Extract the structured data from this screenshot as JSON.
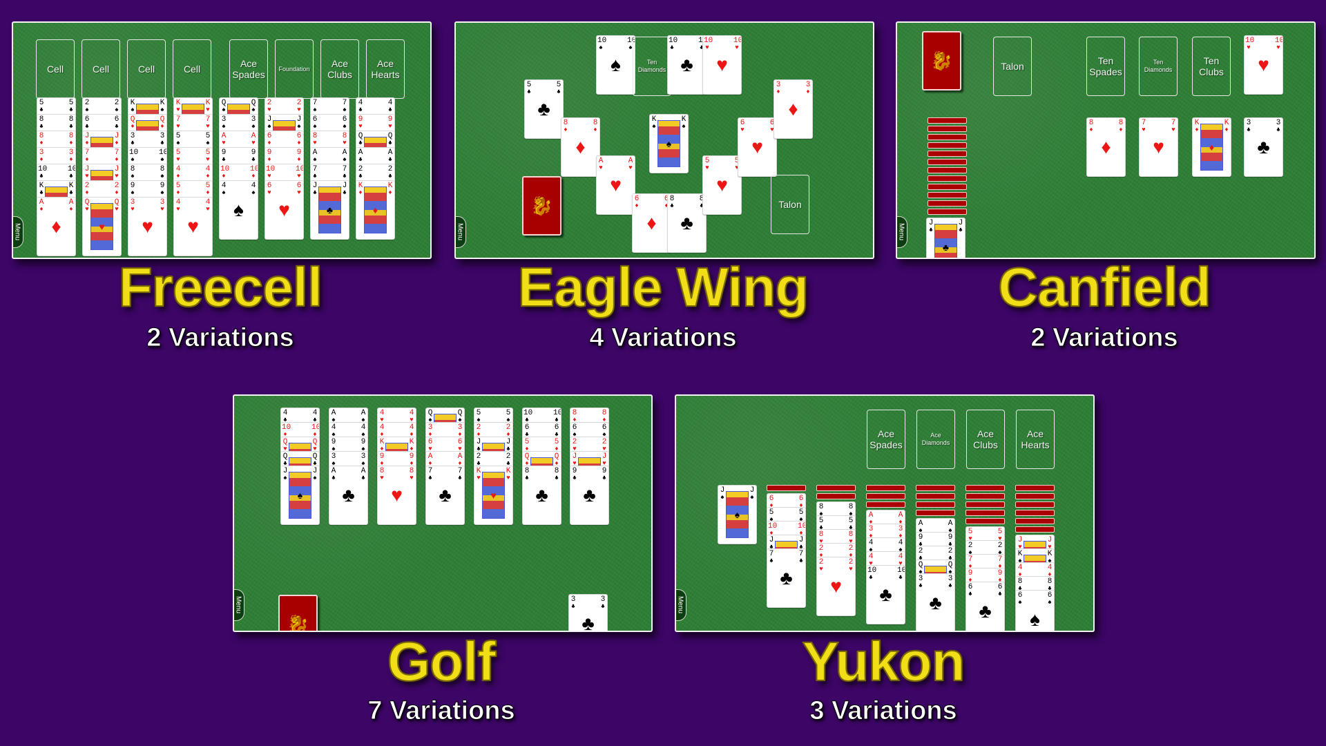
{
  "colors": {
    "background": "#3c0566",
    "felt": "#2f7f36",
    "title": "#f2de16",
    "card_back": "#a80000",
    "red_suit": "#ee1515",
    "black_suit": "#000000"
  },
  "menu_label": "Menu",
  "games": [
    {
      "id": "freecell",
      "title": "Freecell",
      "subtitle": "2 Variations",
      "slots": [
        {
          "label": "Cell"
        },
        {
          "label": "Cell"
        },
        {
          "label": "Cell"
        },
        {
          "label": "Cell"
        },
        {
          "label": "Ace Spades"
        },
        {
          "label": "Foundation",
          "small": true
        },
        {
          "label": "Ace Clubs"
        },
        {
          "label": "Ace Hearts"
        }
      ],
      "tableau": [
        [
          "5♣",
          "8♣",
          "8♦",
          "3♦",
          "10♣",
          "K♣",
          "A♦"
        ],
        [
          "2♠",
          "6♣",
          "J♦",
          "7♦",
          "J♥",
          "2♦",
          "Q♥"
        ],
        [
          "K♠",
          "Q♦",
          "3♣",
          "10♠",
          "8♠",
          "9♠",
          "3♥"
        ],
        [
          "K♥",
          "7♥",
          "5♠",
          "5♥",
          "4♦",
          "5♦",
          "4♥"
        ],
        [
          "Q♠",
          "3♠",
          "A♥",
          "9♣",
          "10♦",
          "4♠"
        ],
        [
          "2♥",
          "J♠",
          "6♦",
          "9♦",
          "10♥",
          "6♥"
        ],
        [
          "7♠",
          "6♠",
          "8♥",
          "A♠",
          "7♣",
          "J♣"
        ],
        [
          "4♣",
          "9♥",
          "Q♣",
          "A♣",
          "2♣",
          "K♦"
        ]
      ]
    },
    {
      "id": "eagle-wing",
      "title": "Eagle Wing",
      "subtitle": "4 Variations",
      "foundations": [
        "10♠",
        {
          "label": "Ten Diamonds"
        },
        "10♣",
        "10♥"
      ],
      "wing_cards": [
        "5♣",
        "8♦",
        "A♥",
        "6♦",
        "8♣",
        "5♥",
        "6♥",
        "3♦"
      ],
      "trunk": "K♠",
      "stock": "back",
      "talon": {
        "label": "Talon"
      }
    },
    {
      "id": "canfield",
      "title": "Canfield",
      "subtitle": "2 Variations",
      "stock": "back",
      "talon": {
        "label": "Talon"
      },
      "foundations": [
        {
          "label": "Ten Spades"
        },
        {
          "label": "Ten Diamonds"
        },
        {
          "label": "Ten Clubs"
        },
        "10♥"
      ],
      "reserve_backs": 12,
      "reserve_top": "J♣",
      "tableau": [
        "8♦",
        "7♥",
        "K♦",
        "3♣"
      ]
    },
    {
      "id": "golf",
      "title": "Golf",
      "subtitle": "7 Variations",
      "tableau": [
        [
          "4♣",
          "10♦",
          "Q♥",
          "Q♣",
          "J♠"
        ],
        [
          "A♠",
          "4♠",
          "9♠",
          "3♠",
          "A♣"
        ],
        [
          "4♥",
          "4♦",
          "K♦",
          "9♦",
          "8♥"
        ],
        [
          "Q♠",
          "3♦",
          "6♥",
          "A♦",
          "7♣"
        ],
        [
          "5♠",
          "2♦",
          "J♣",
          "2♣",
          "K♥"
        ],
        [
          "10♣",
          "6♣",
          "5♦",
          "Q♦",
          "8♣"
        ],
        [
          "8♦",
          "6♠",
          "2♥",
          "J♥",
          "9♣"
        ]
      ],
      "stock": "back",
      "waste": "3♣"
    },
    {
      "id": "yukon",
      "title": "Yukon",
      "subtitle": "3 Variations",
      "foundations": [
        {
          "label": "Ace Spades"
        },
        {
          "label": "Ace Diamonds",
          "small": true
        },
        {
          "label": "Ace Clubs"
        },
        {
          "label": "Ace Hearts"
        }
      ],
      "tableau": [
        {
          "backs": 0,
          "cards": [
            "J♠"
          ]
        },
        {
          "backs": 1,
          "cards": [
            "6♦",
            "5♠",
            "10♦",
            "J♣",
            "7♣"
          ]
        },
        {
          "backs": 2,
          "cards": [
            "8♠",
            "5♣",
            "8♥",
            "2♦",
            "2♥"
          ]
        },
        {
          "backs": 3,
          "cards": [
            "A♦",
            "3♦",
            "4♠",
            "4♥",
            "10♣"
          ]
        },
        {
          "backs": 4,
          "cards": [
            "A♠",
            "9♣",
            "2♣",
            "Q♠",
            "3♣"
          ]
        },
        {
          "backs": 5,
          "cards": [
            "5♥",
            "2♠",
            "7♦",
            "9♦",
            "6♣"
          ]
        },
        {
          "backs": 6,
          "cards": [
            "J♥",
            "K♠",
            "4♦",
            "8♣",
            "6♠"
          ]
        }
      ]
    }
  ]
}
